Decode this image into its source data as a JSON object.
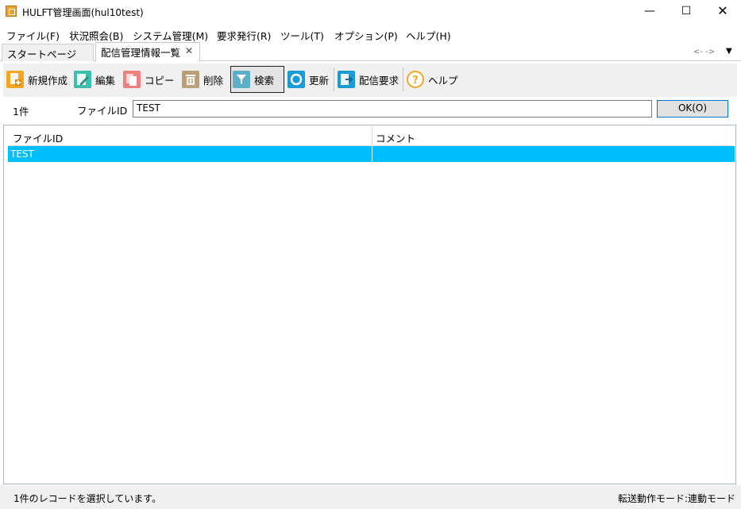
{
  "window": {
    "title": "HULFT管理画面(hul10test)",
    "minimize_glyph": "—",
    "maximize_glyph": "☐",
    "close_glyph": "✕"
  },
  "menu": [
    {
      "label": "ファイル(F)"
    },
    {
      "label": "状況照会(B)"
    },
    {
      "label": "システム管理(M)"
    },
    {
      "label": "要求発行(R)"
    },
    {
      "label": "ツール(T)"
    },
    {
      "label": "オプション(P)"
    },
    {
      "label": "ヘルプ(H)"
    }
  ],
  "tabs": [
    {
      "label": "スタートページ",
      "active": false
    },
    {
      "label": "配信管理情報一覧",
      "active": true,
      "close_glyph": "✕"
    }
  ],
  "tab_nav": {
    "arrows": "<- ->",
    "menu_glyph": "▼"
  },
  "toolbar": [
    {
      "label": "新規作成",
      "icon": "new-document-icon",
      "color": "#f5a623"
    },
    {
      "label": "編集",
      "icon": "edit-icon",
      "color": "#3cbfae"
    },
    {
      "label": "コピー",
      "icon": "copy-icon",
      "color": "#f08080"
    },
    {
      "label": "削除",
      "icon": "trash-icon",
      "color": "#b8a17a"
    },
    {
      "label": "検索",
      "icon": "filter-icon",
      "color": "#5bb0c8",
      "active": true
    },
    {
      "label": "更新",
      "icon": "refresh-icon",
      "color": "#1a9bd7"
    },
    {
      "label": "配信要求",
      "icon": "send-request-icon",
      "color": "#1a9bd7"
    },
    {
      "label": "ヘルプ",
      "icon": "help-icon",
      "color": "#f5a623"
    }
  ],
  "filter": {
    "count": "1件",
    "fileid_label": "ファイルID",
    "fileid_value": "TEST",
    "ok_label": "OK(O)"
  },
  "grid": {
    "columns": [
      "ファイルID",
      "コメント"
    ],
    "rows": [
      {
        "file_id": "TEST",
        "comment": "",
        "selected": true
      }
    ],
    "selection_color": "#00bfff"
  },
  "status": {
    "left": "1件のレコードを選択しています。",
    "right": "転送動作モード:連動モード"
  }
}
